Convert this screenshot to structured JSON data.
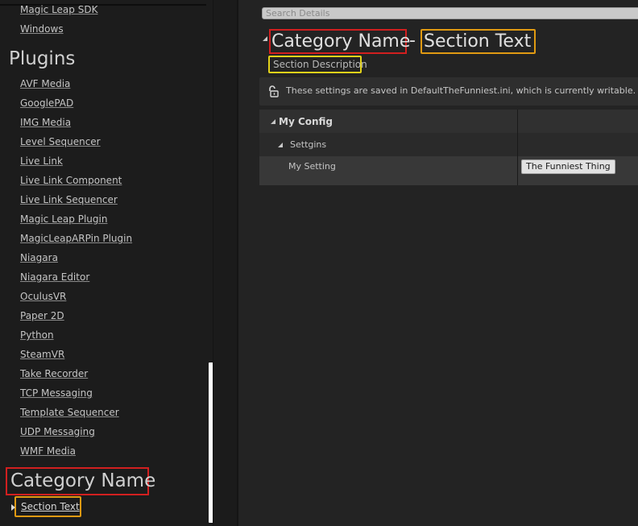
{
  "sidebar": {
    "top_items": [
      "Magic Leap SDK",
      "Windows"
    ],
    "plugins_heading": "Plugins",
    "plugins": [
      "AVF Media",
      "GooglePAD",
      "IMG Media",
      "Level Sequencer",
      "Live Link",
      "Live Link Component",
      "Live Link Sequencer",
      "Magic Leap Plugin",
      "MagicLeapARPin Plugin",
      "Niagara",
      "Niagara Editor",
      "OculusVR",
      "Paper 2D",
      "Python",
      "SteamVR",
      "Take Recorder",
      "TCP Messaging",
      "Template Sequencer",
      "UDP Messaging",
      "WMF Media"
    ],
    "category_heading": "Category Name",
    "section_item": "Section Text"
  },
  "main": {
    "search_placeholder": "Search Details",
    "title_category": "Category Name",
    "title_separator": "-",
    "title_section": "Section Text",
    "section_description": "Section Description",
    "config_banner": "These settings are saved in DefaultTheFunniest.ini, which is currently writable.",
    "details": {
      "group_label": "My Config",
      "subgroup_label": "Settgins",
      "property_label": "My Setting",
      "property_value": "The Funniest Thing"
    }
  },
  "colors": {
    "annotation_red": "#d11f1f",
    "annotation_orange": "#e09a12",
    "annotation_yellow": "#e3d21a"
  },
  "icons": {
    "banner_icon": "unlocked-padlock-icon",
    "expand_icon": "collapse-triangle-icon"
  }
}
